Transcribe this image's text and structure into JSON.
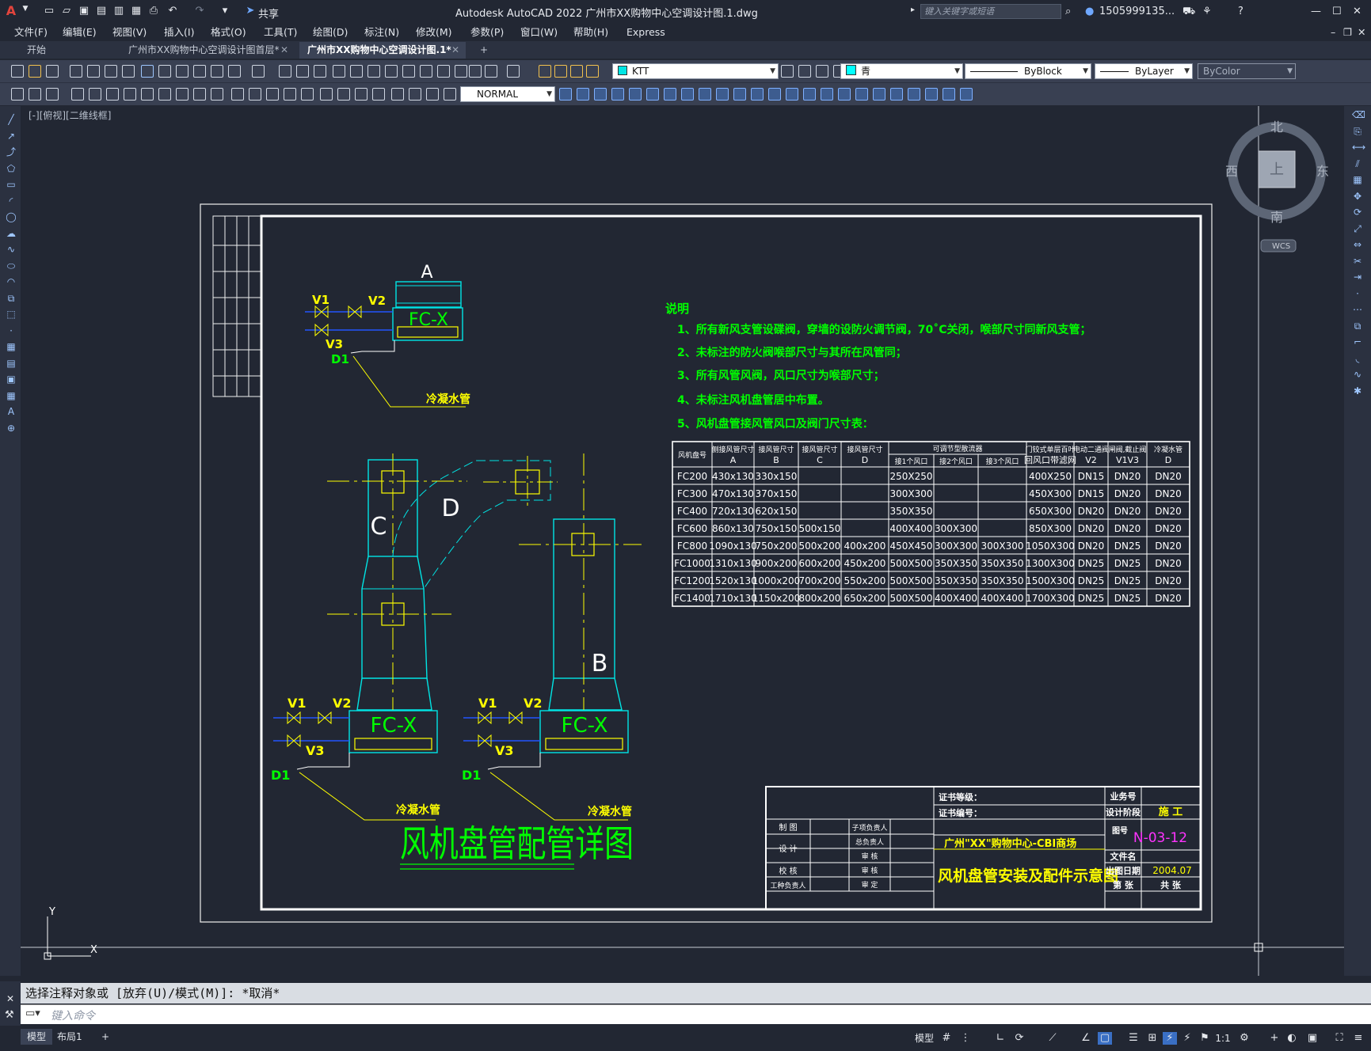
{
  "titlebar": {
    "app_title": "Autodesk AutoCAD 2022   广州市XX购物中心空调设计图.1.dwg",
    "share_label": "共享",
    "search_placeholder": "键入关键字或短语",
    "user": "1505999135...",
    "help": "?"
  },
  "menu": [
    "文件(F)",
    "编辑(E)",
    "视图(V)",
    "插入(I)",
    "格式(O)",
    "工具(T)",
    "绘图(D)",
    "标注(N)",
    "修改(M)",
    "参数(P)",
    "窗口(W)",
    "帮助(H)",
    "Express"
  ],
  "tabs": [
    {
      "label": "开始"
    },
    {
      "label": "广州市XX购物中心空调设计图首层*"
    },
    {
      "label": "广州市XX购物中心空调设计图.1*"
    }
  ],
  "toolbar": {
    "layer": "KTT",
    "color": "青",
    "linetype": "ByBlock",
    "lineweight": "ByLayer",
    "plotstyle": "ByColor",
    "dimstyle": "NORMAL"
  },
  "viewport_label": "[-][俯视][二维线框]",
  "viewcube": {
    "north": "北",
    "south": "南",
    "east": "东",
    "west": "西",
    "top": "上",
    "wcs": "WCS"
  },
  "drawing": {
    "main_title": "风机盘管配管详图",
    "unit_label": "FC-X",
    "valve_labels": {
      "v1": "V1",
      "v2": "V2",
      "v3": "V3",
      "d1": "D1"
    },
    "letters": {
      "a": "A",
      "b": "B",
      "c": "C",
      "d": "D"
    },
    "condensate_label": "冷凝水管",
    "notes_heading": "说明",
    "notes": [
      "1、所有新风支管设碟阀，穿墙的设防火调节阀，70˚C关闭，喉部尺寸同新风支管；",
      "2、未标注的防火阀喉部尺寸与其所在风管同；",
      "3、所有风管风阀，风口尺寸为喉部尺寸；",
      "4、未标注风机盘管居中布置。",
      "5、风机盘管接风管风口及阀门尺寸表："
    ],
    "table": {
      "headers": [
        "风机盘号",
        "侧接风管尺寸\nA",
        "接风管尺寸\nB",
        "接风管尺寸\nC",
        "接风管尺寸\nD",
        "可调节型散流器",
        "",
        "",
        "门铰式单层百叶\n回风口带滤网",
        "电动二通阀\nV2",
        "闸阀,截止阀\nV1V3",
        "冷凝水管\nD"
      ],
      "subheaders": [
        "接1个风口",
        "接2个风口",
        "接3个风口"
      ],
      "rows": [
        [
          "FC200",
          "430x130",
          "330x150",
          "",
          "",
          "250X250",
          "",
          "",
          "400X250",
          "DN15",
          "DN20",
          "DN20"
        ],
        [
          "FC300",
          "470x130",
          "370x150",
          "",
          "",
          "300X300",
          "",
          "",
          "450X300",
          "DN15",
          "DN20",
          "DN20"
        ],
        [
          "FC400",
          "720x130",
          "620x150",
          "",
          "",
          "350X350",
          "",
          "",
          "650X300",
          "DN20",
          "DN20",
          "DN20"
        ],
        [
          "FC600",
          "860x130",
          "750x150",
          "500x150",
          "",
          "400X400",
          "300X300",
          "",
          "850X300",
          "DN20",
          "DN20",
          "DN20"
        ],
        [
          "FC800",
          "1090x130",
          "750x200",
          "500x200",
          "400x200",
          "450X450",
          "300X300",
          "300X300",
          "1050X300",
          "DN20",
          "DN25",
          "DN20"
        ],
        [
          "FC1000",
          "1310x130",
          "900x200",
          "600x200",
          "450x200",
          "500X500",
          "350X350",
          "350X350",
          "1300X300",
          "DN25",
          "DN25",
          "DN20"
        ],
        [
          "FC1200",
          "1520x130",
          "1000x200",
          "700x200",
          "550x200",
          "500X500",
          "350X350",
          "350X350",
          "1500X300",
          "DN25",
          "DN25",
          "DN20"
        ],
        [
          "FC1400",
          "1710x130",
          "1150x200",
          "800x200",
          "650x200",
          "500X500",
          "400X400",
          "400X400",
          "1700X300",
          "DN25",
          "DN25",
          "DN20"
        ]
      ]
    },
    "title_block": {
      "cert_level": "证书等级：",
      "cert_no": "证书编号：",
      "business_no": "业务号",
      "design_stage_label": "设计阶段",
      "design_stage": "施 工",
      "drawing_no_label": "图号",
      "drawing_no": "N-03-12",
      "project": "广州\"XX\"购物中心-CBI商场",
      "drawing_name": "风机盘管安装及配件示意图",
      "file_name_label": "文件名",
      "date_label": "出图日期",
      "date": "2004.07",
      "sheet_label": "第 张",
      "total_label": "共 张",
      "roles_left": [
        "制 图",
        "设 计",
        "校 核",
        "工种负责人"
      ],
      "roles_right": [
        "子项负责人",
        "总负责人",
        "审 核",
        "审 核",
        "审 定"
      ]
    }
  },
  "command": {
    "history": "选择注释对象或 [放弃(U)/模式(M)]: *取消*",
    "placeholder": "键入命令"
  },
  "status": {
    "model_tab": "模型",
    "layout_tab": "布局1",
    "model_button": "模型",
    "scale": "1:1"
  }
}
